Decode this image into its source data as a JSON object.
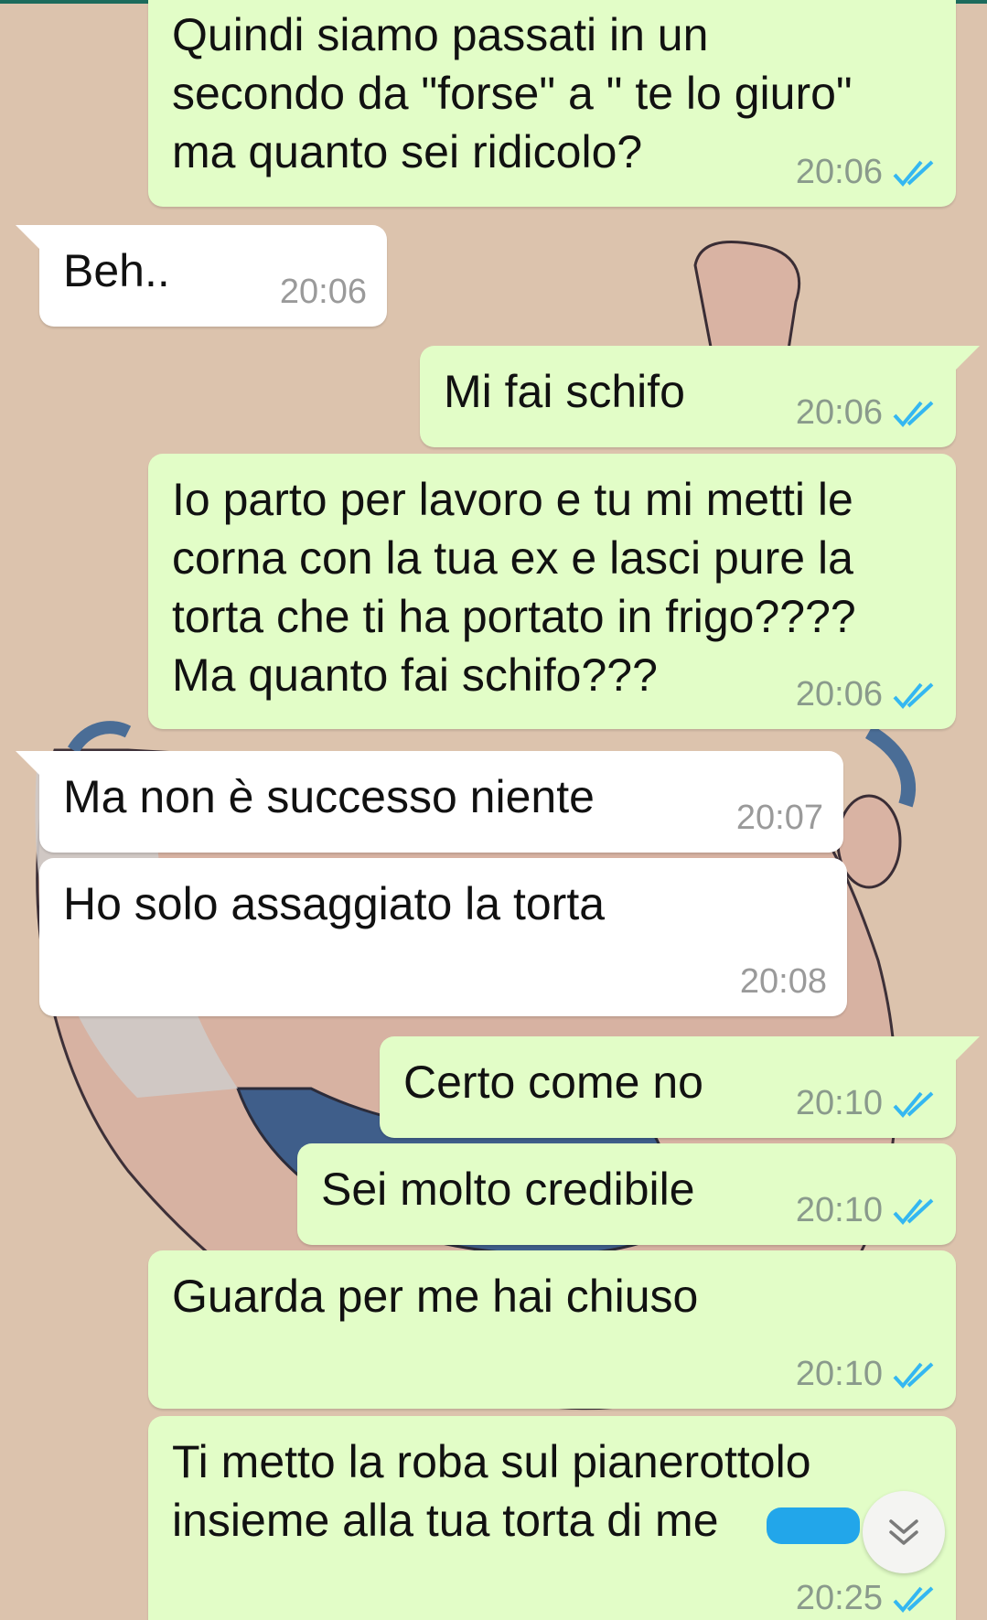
{
  "colors": {
    "outgoing_bubble": "#e2fdc7",
    "incoming_bubble": "#ffffff",
    "read_ticks": "#34b7f1",
    "redaction": "#22a6ea",
    "wallpaper": "#dcc3ad"
  },
  "messages": [
    {
      "dir": "out",
      "text": "Quindi siamo passati in un\nsecondo da \"forse\" a \" te lo giuro\"\nma quanto sei ridicolo?",
      "time": "20:06",
      "status_icon": "double-check-read-icon"
    },
    {
      "dir": "in",
      "text": "Beh..",
      "time": "20:06"
    },
    {
      "dir": "out",
      "text": "Mi fai schifo",
      "time": "20:06",
      "status_icon": "double-check-read-icon"
    },
    {
      "dir": "out",
      "text": "Io parto per lavoro e tu mi metti le\ncorna con la tua ex e lasci pure la\ntorta che ti ha portato in frigo????\nMa quanto fai schifo???",
      "time": "20:06",
      "status_icon": "double-check-read-icon"
    },
    {
      "dir": "in",
      "text": "Ma non è successo niente",
      "time": "20:07"
    },
    {
      "dir": "in",
      "text": "Ho solo assaggiato la torta",
      "time": "20:08"
    },
    {
      "dir": "out",
      "text": "Certo come no",
      "time": "20:10",
      "status_icon": "double-check-read-icon"
    },
    {
      "dir": "out",
      "text": "Sei molto credibile",
      "time": "20:10",
      "status_icon": "double-check-read-icon"
    },
    {
      "dir": "out",
      "text": "Guarda per me hai chiuso",
      "time": "20:10",
      "status_icon": "double-check-read-icon"
    },
    {
      "dir": "out",
      "text": "Ti metto la roba sul pianerottolo\ninsieme alla tua torta di me",
      "time": "20:25",
      "status_icon": "double-check-read-icon"
    }
  ],
  "scroll_button_icon": "double-chevron-down-icon"
}
